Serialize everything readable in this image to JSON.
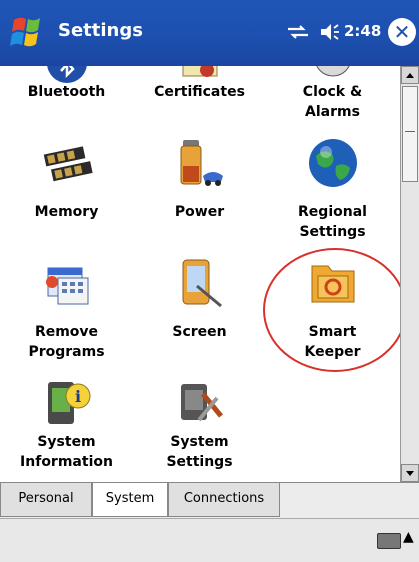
{
  "titlebar": {
    "title": "Settings",
    "time": "2:48",
    "close_glyph": "✕",
    "icons": [
      "windows-start-logo",
      "connectivity-icon",
      "volume-icon",
      "close-icon"
    ]
  },
  "settings_items": [
    {
      "label": "Bluetooth",
      "icon": "bluetooth-icon"
    },
    {
      "label": "Certificates",
      "icon": "certificates-icon"
    },
    {
      "label": "Clock &\nAlarms",
      "icon": "clock-icon"
    },
    {
      "label": "Memory",
      "icon": "memory-icon"
    },
    {
      "label": "Power",
      "icon": "power-icon"
    },
    {
      "label": "Regional\nSettings",
      "icon": "globe-icon"
    },
    {
      "label": "Remove\nPrograms",
      "icon": "remove-programs-icon"
    },
    {
      "label": "Screen",
      "icon": "screen-icon"
    },
    {
      "label": "Smart\nKeeper",
      "icon": "smart-keeper-icon"
    },
    {
      "label": "System\nInformation",
      "icon": "system-information-icon"
    },
    {
      "label": "System\nSettings",
      "icon": "system-settings-icon"
    }
  ],
  "tabs": [
    {
      "label": "Personal",
      "active": false
    },
    {
      "label": "System",
      "active": true
    },
    {
      "label": "Connections",
      "active": false
    }
  ],
  "bottombar": {
    "keyboard_icon": "keyboard-icon",
    "arrow": "▲"
  },
  "colors": {
    "titlebar": "#1d4fae",
    "annotation": "#d9302b"
  }
}
